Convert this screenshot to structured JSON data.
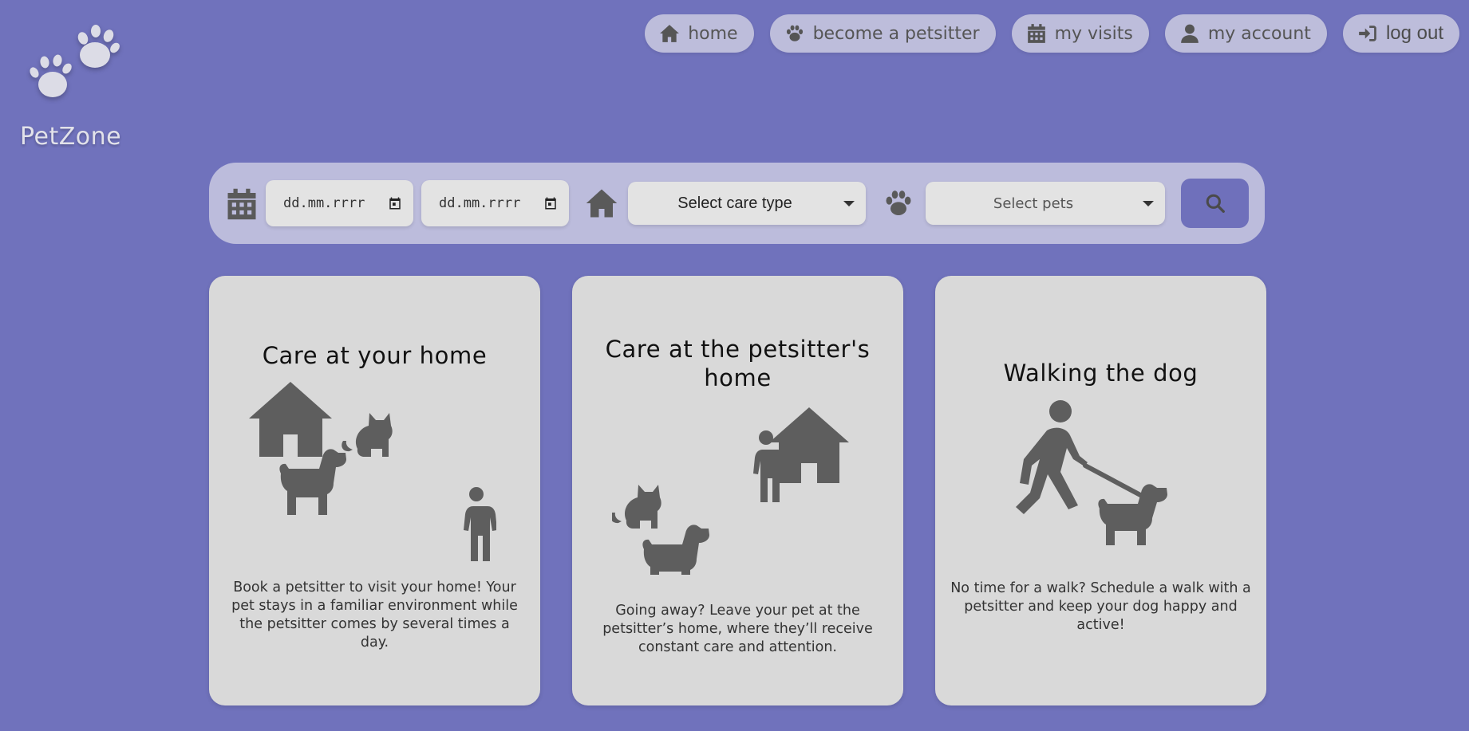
{
  "brand": {
    "name": "PetZone"
  },
  "nav": {
    "items": [
      {
        "label": "home",
        "icon": "home-icon"
      },
      {
        "label": "become a petsitter",
        "icon": "paw-icon"
      },
      {
        "label": "my visits",
        "icon": "calendar-icon"
      },
      {
        "label": "my account",
        "icon": "user-icon"
      },
      {
        "label": "log out",
        "icon": "log-in-icon"
      }
    ]
  },
  "search": {
    "date_from": "dd.mm.rrrr",
    "date_to": "dd.mm.rrrr",
    "care_type": "Select care type",
    "pets": "Select pets"
  },
  "cards": [
    {
      "title": "Care at your home",
      "description": "Book a petsitter to visit your home! Your pet stays in a familiar environment while the petsitter comes by several times a day."
    },
    {
      "title": "Care at the petsitter's home",
      "description": "Going away? Leave your pet at the petsitter’s home, where they’ll receive constant care and attention."
    },
    {
      "title": "Walking the dog",
      "description": "No time for a walk? Schedule a walk with a petsitter and keep your dog happy and active!"
    }
  ],
  "colors": {
    "background": "#7072bc",
    "card": "#d9d9d9",
    "search_bar": "#bcbcdc",
    "nav_button": "#bdbddb",
    "search_button": "#6f70bb",
    "icon": "#5e5e5e"
  }
}
